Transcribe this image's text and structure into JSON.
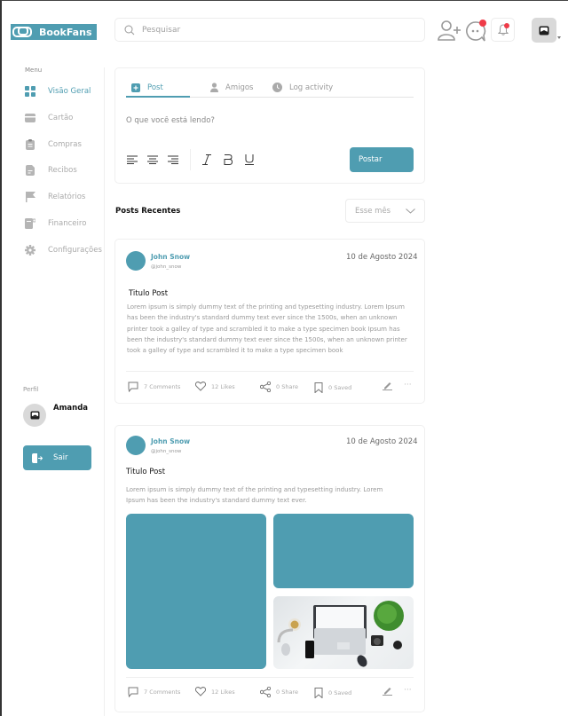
{
  "app": {
    "name": "BookFans"
  },
  "header": {
    "search_placeholder": "Pesquisar",
    "icons": [
      "add-friend-icon",
      "chat-icon",
      "bell-icon",
      "avatar-image-icon"
    ],
    "notification_color": "#ef3b48"
  },
  "sidebar": {
    "menu_label": "Menu",
    "items": [
      {
        "label": "Visão Geral",
        "icon": "grid-icon",
        "active": true
      },
      {
        "label": "Cartão",
        "icon": "card-icon",
        "active": false
      },
      {
        "label": "Compras",
        "icon": "clipboard-icon",
        "active": false
      },
      {
        "label": "Recibos",
        "icon": "document-icon",
        "active": false
      },
      {
        "label": "Relatórios",
        "icon": "flag-icon",
        "active": false
      },
      {
        "label": "Financeiro",
        "icon": "finance-icon",
        "active": false
      },
      {
        "label": "Configurações",
        "icon": "gear-icon",
        "active": false
      }
    ],
    "profile_label": "Perfil",
    "profile_name": "Amanda",
    "logout_label": "Sair"
  },
  "composer": {
    "tabs": [
      {
        "label": "Post",
        "icon": "plus-square-icon",
        "active": true
      },
      {
        "label": "Amigos",
        "icon": "user-icon",
        "active": false
      },
      {
        "label": "Log activity",
        "icon": "clock-icon",
        "active": false
      }
    ],
    "placeholder": "O que você está lendo?",
    "format_buttons": [
      "align-left",
      "align-center",
      "align-right",
      "italic",
      "bold",
      "underline"
    ],
    "submit_label": "Postar"
  },
  "feed": {
    "title": "Posts Recentes",
    "filter_value": "Esse mês",
    "posts": [
      {
        "author": "John Snow",
        "handle": "@john_snow",
        "date": "10 de Agosto 2024",
        "title": "Titulo Post",
        "body": "Lorem ipsum is simply dummy text of the printing and typesetting industry. Lorem Ipsum has been the industry's standard dummy text ever since the 1500s, when an unknown printer took a galley of type and scrambled it to make a type specimen book Ipsum has been the industry's standard dummy text ever since the 1500s, when an unknown printer took a galley of type and scrambled it to make a type specimen book",
        "comments": "7 Comments",
        "likes": "12 Likes",
        "shares": "0 Share",
        "saved": "0 Saved"
      },
      {
        "author": "John Snow",
        "handle": "@john_snow",
        "date": "10 de Agosto 2024",
        "title": "Titulo Post",
        "body": "Lorem ipsum is simply dummy text of the printing and typesetting industry. Lorem Ipsum has been the industry's standard dummy text ever.",
        "images": [
          "placeholder-image",
          "placeholder-image",
          "desk-photo"
        ],
        "comments": "7 Comments",
        "likes": "12 Likes",
        "shares": "0 Share",
        "saved": "0 Saved"
      }
    ]
  },
  "colors": {
    "accent": "#4f9db1",
    "badge": "#ef3b48"
  }
}
